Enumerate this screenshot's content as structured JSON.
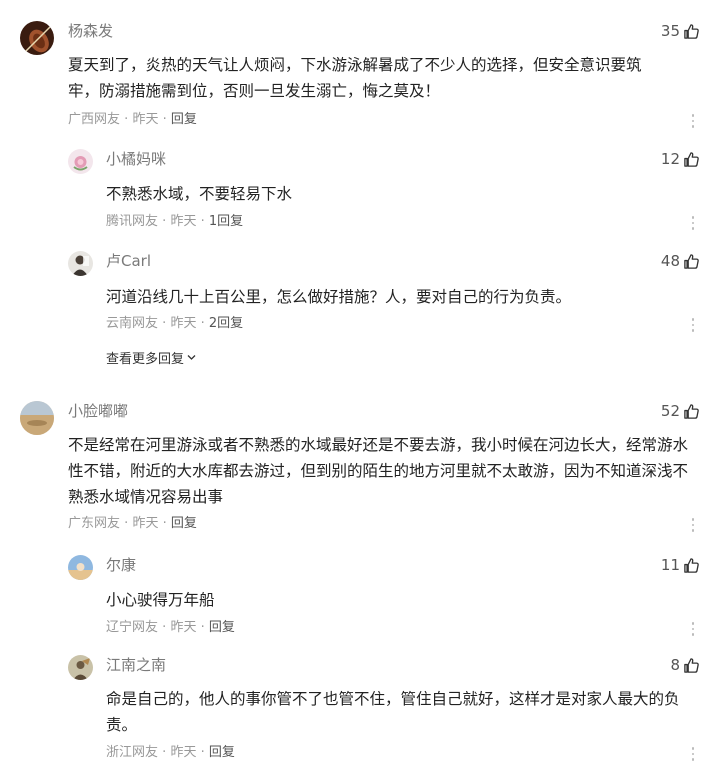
{
  "comments": [
    {
      "user": "杨森发",
      "likes": "35",
      "text": "夏天到了，炎热的天气让人烦闷，下水游泳解暑成了不少人的选择，但安全意识要筑牢，防溺措施需到位，否则一旦发生溺亡，悔之莫及！",
      "location": "广西网友",
      "time": "昨天",
      "reply_label": "回复",
      "replies": [
        {
          "user": "小橘妈咪",
          "likes": "12",
          "text": "不熟悉水域，不要轻易下水",
          "location": "腾讯网友",
          "time": "昨天",
          "reply_label": "1回复"
        },
        {
          "user": "卢Carl",
          "likes": "48",
          "text": "河道沿线几十上百公里，怎么做好措施？人，要对自己的行为负责。",
          "location": "云南网友",
          "time": "昨天",
          "reply_label": "2回复"
        }
      ],
      "see_more": "查看更多回复"
    },
    {
      "user": "小脸嘟嘟",
      "likes": "52",
      "text": "不是经常在河里游泳或者不熟悉的水域最好还是不要去游，我小时候在河边长大，经常游水性不错，附近的大水库都去游过，但到别的陌生的地方河里就不太敢游，因为不知道深浅不熟悉水域情况容易出事",
      "location": "广东网友",
      "time": "昨天",
      "reply_label": "回复",
      "replies": [
        {
          "user": "尔康",
          "likes": "11",
          "text": "小心驶得万年船",
          "location": "辽宁网友",
          "time": "昨天",
          "reply_label": "回复"
        },
        {
          "user": "江南之南",
          "likes": "8",
          "text": "命是自己的，他人的事你管不了也管不住，管住自己就好，这样才是对家人最大的负责。",
          "location": "浙江网友",
          "time": "昨天",
          "reply_label": "回复"
        }
      ]
    }
  ],
  "separator": "·",
  "colors": {
    "username": "#7a7a7a",
    "meta": "#999999",
    "text": "#222222"
  }
}
